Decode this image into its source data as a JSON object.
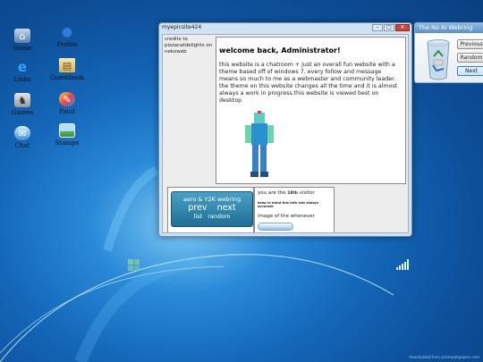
{
  "desktop": {
    "icons": [
      {
        "label": "Home",
        "icon": "home-icon"
      },
      {
        "label": "Links",
        "icon": "ie-links-icon"
      },
      {
        "label": "Games",
        "icon": "games-icon"
      },
      {
        "label": "Chat",
        "icon": "chat-icon"
      },
      {
        "label": "Profile",
        "icon": "profile-icon"
      },
      {
        "label": "Guestbook",
        "icon": "guestbook-icon"
      },
      {
        "label": "Paint",
        "icon": "paint-icon"
      },
      {
        "label": "Stamps",
        "icon": "stamps-icon"
      }
    ],
    "watermark": "downloaded from pcbmwallpapers.com"
  },
  "window": {
    "title": "myepicsite424",
    "controls": [
      "–",
      "□",
      "✕"
    ],
    "credits": "credits to pizzacatdelights on nekoweb",
    "heading": "welcome back, Administrator!",
    "body": "this website is a chatroom + just an overall fun website with a theme based off of windows 7. every follow and message means so much to me as a webmaster and community leader. the theme on this website changes all the time and it is almost always a work in progress.this website is viewed best on desktop",
    "webring": {
      "title": "aero & Y2K webring",
      "prev": "prev",
      "next": "next",
      "list": "list",
      "random": "random"
    },
    "visitor": {
      "prefix": "you are the",
      "count": "18th",
      "suffix": "visitor",
      "note": "keep in mind this info isnt always accurate",
      "image_caption": "image of the whenever"
    }
  },
  "gadget": {
    "title": "The No AI Webring",
    "buttons": [
      "Previous",
      "Random",
      "Next"
    ],
    "active": "Next"
  },
  "colors": {
    "accent": "#2a8ad8",
    "webring_button": "#1f6f97",
    "close_button": "#c9473f"
  }
}
